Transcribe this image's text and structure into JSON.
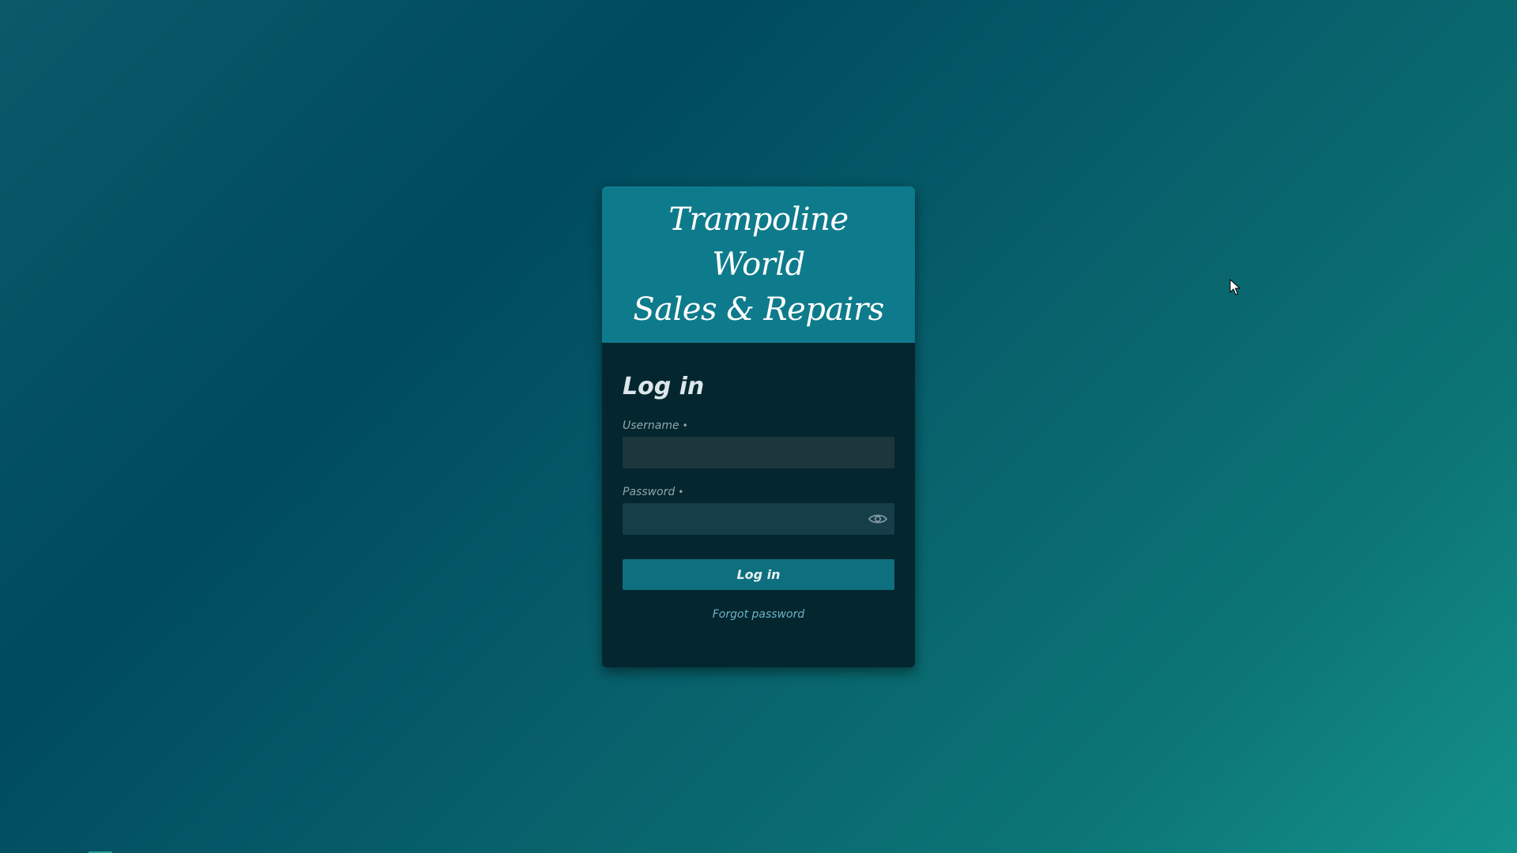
{
  "brand": {
    "line1": "Trampoline World",
    "line2": "Sales & Repairs"
  },
  "login": {
    "heading": "Log in",
    "username_label": "Username",
    "password_label": "Password",
    "required_marker": "•",
    "username_value": "",
    "password_value": "",
    "submit_label": "Log in",
    "forgot_label": "Forgot password"
  },
  "icons": {
    "password_toggle": "eye-icon",
    "pointer": "mouse-cursor-icon"
  },
  "colors": {
    "header": "#0e7b8c",
    "card": "#04262f",
    "button": "#0e6f7e",
    "link": "#6fb3c5"
  }
}
